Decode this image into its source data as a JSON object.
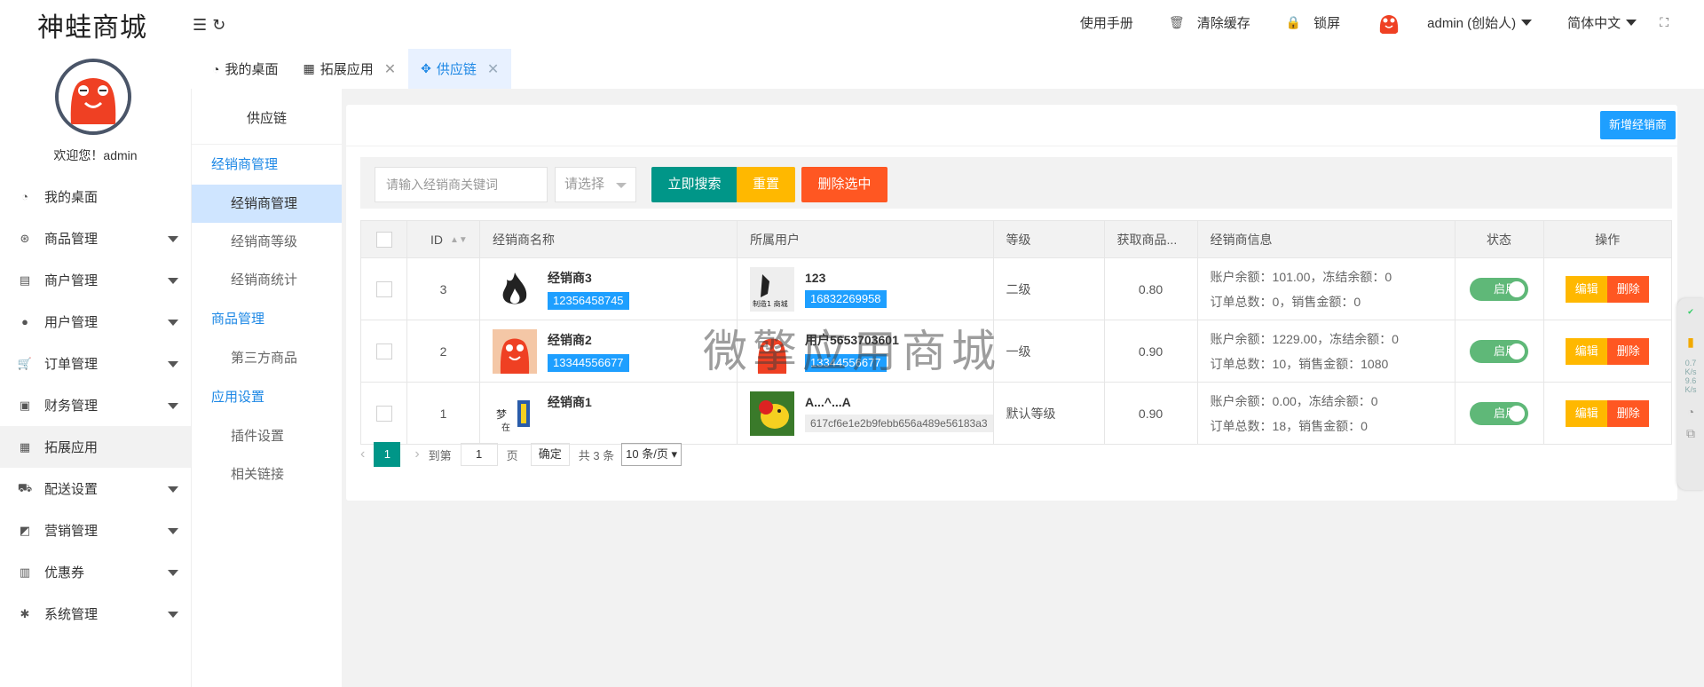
{
  "app": {
    "logo": "神蛙商城",
    "welcome": "欢迎您！admin"
  },
  "sidebar": {
    "items": [
      {
        "label": "我的桌面",
        "icon": "dashboard-icon",
        "caret": false
      },
      {
        "label": "商品管理",
        "icon": "goods-icon",
        "caret": true
      },
      {
        "label": "商户管理",
        "icon": "merchant-icon",
        "caret": true
      },
      {
        "label": "用户管理",
        "icon": "user-icon",
        "caret": true
      },
      {
        "label": "订单管理",
        "icon": "cart-icon",
        "caret": true
      },
      {
        "label": "财务管理",
        "icon": "money-icon",
        "caret": true
      },
      {
        "label": "拓展应用",
        "icon": "apps-icon",
        "caret": false,
        "active": true
      },
      {
        "label": "配送设置",
        "icon": "truck-icon",
        "caret": true
      },
      {
        "label": "营销管理",
        "icon": "marketing-icon",
        "caret": true
      },
      {
        "label": "优惠券",
        "icon": "coupon-icon",
        "caret": true
      },
      {
        "label": "系统管理",
        "icon": "gear-icon",
        "caret": true
      }
    ]
  },
  "header": {
    "manual": "使用手册",
    "clear_cache": "清除缓存",
    "lock": "锁屏",
    "user": "admin (创始人)",
    "language": "简体中文"
  },
  "tabs": [
    {
      "label": "我的桌面",
      "icon": "dashboard-icon",
      "closable": false
    },
    {
      "label": "拓展应用",
      "icon": "apps-icon",
      "closable": true
    },
    {
      "label": "供应链",
      "icon": "supply-icon",
      "closable": true,
      "active": true
    }
  ],
  "submenu": {
    "title": "供应链",
    "groups": [
      {
        "label": "经销商管理",
        "items": [
          "经销商管理",
          "经销商等级",
          "经销商统计"
        ]
      },
      {
        "label": "商品管理",
        "items": [
          "第三方商品"
        ]
      },
      {
        "label": "应用设置",
        "items": [
          "插件设置",
          "相关链接"
        ]
      }
    ]
  },
  "main": {
    "new_button": "新增经销商",
    "search_placeholder": "请输入经销商关键词",
    "select_placeholder": "请选择",
    "search_button": "立即搜索",
    "reset_button": "重置",
    "delete_selected_button": "删除选中",
    "columns": [
      "ID",
      "经销商名称",
      "所属用户",
      "等级",
      "获取商品...",
      "经销商信息",
      "状态",
      "操作"
    ],
    "rows": [
      {
        "id": "3",
        "name": "经销商3",
        "phone": "12356458745",
        "user_name": "123",
        "user_phone": "16832269958",
        "user_phone_style": "blue",
        "level": "二级",
        "rate": "0.80",
        "info1": "账户余额：101.00，冻结余额：0",
        "info2": "订单总数：0，销售金额：0",
        "status": "启用",
        "edit": "编辑",
        "delete": "删除"
      },
      {
        "id": "2",
        "name": "经销商2",
        "phone": "13344556677",
        "user_name": "用户5653703601",
        "user_phone": "13344556677",
        "user_phone_style": "blue",
        "level": "一级",
        "rate": "0.90",
        "info1": "账户余额：1229.00，冻结余额：0",
        "info2": "订单总数：10，销售金额：1080",
        "status": "启用",
        "edit": "编辑",
        "delete": "删除"
      },
      {
        "id": "1",
        "name": "经销商1",
        "phone": "",
        "user_name": "A...^...A",
        "user_phone": "617cf6e1e2b9febb656a489e56183a3",
        "user_phone_style": "gray",
        "level": "默认等级",
        "rate": "0.90",
        "info1": "账户余额：0.00，冻结余额：0",
        "info2": "订单总数：18，销售金额：0",
        "status": "启用",
        "edit": "编辑",
        "delete": "删除"
      }
    ],
    "pager": {
      "current": "1",
      "goto_label": "到第",
      "page_value": "1",
      "page_unit": "页",
      "confirm": "确定",
      "total": "共 3 条",
      "page_size": "10 条/页"
    }
  },
  "watermark": "微擎应用商城",
  "float_widget": {
    "up": "0.7",
    "up_unit": "K/s",
    "down": "9.6",
    "down_unit": "K/s"
  },
  "colors": {
    "primary": "#1e9fff",
    "green": "#009688",
    "yellow": "#ffb800",
    "red": "#ff5722",
    "switch": "#5fb878"
  }
}
